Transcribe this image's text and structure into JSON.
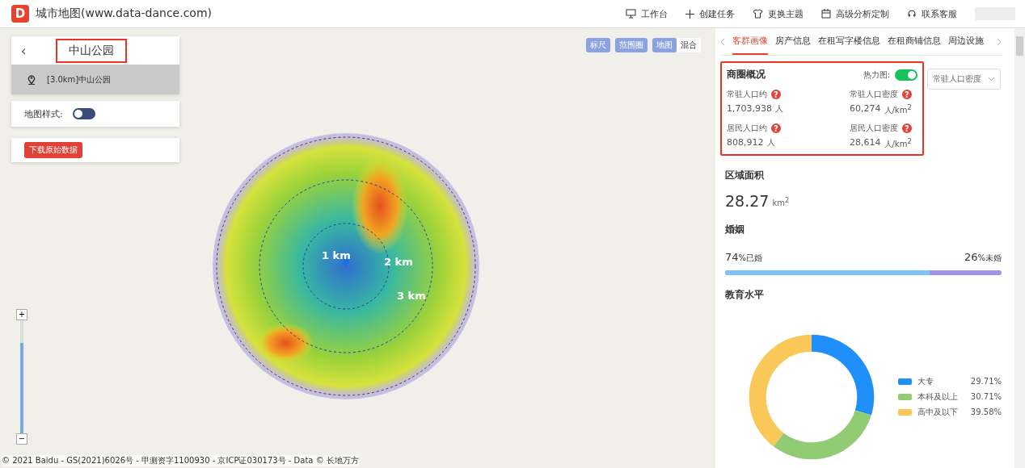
{
  "header": {
    "logo": "D",
    "title": "城市地图(www.data-dance.com)",
    "nav": [
      {
        "label": "工作台",
        "kind": "monitor"
      },
      {
        "label": "创建任务",
        "kind": "plus"
      },
      {
        "label": "更换主题",
        "kind": "shirt"
      },
      {
        "label": "高级分析定制",
        "kind": "calendar"
      },
      {
        "label": "联系客服",
        "kind": "headset"
      }
    ]
  },
  "search_panel": {
    "back": "‹",
    "title": "中山公园",
    "result": "[3.0km]中山公园",
    "map_style": {
      "label": "地图样式:",
      "on": false
    },
    "download_button": "下载原始数据"
  },
  "map": {
    "tools": [
      {
        "label": "标尺",
        "selected": false
      },
      {
        "label": "范围圈",
        "selected": false
      }
    ],
    "layers": [
      {
        "label": "地图",
        "selected": false
      },
      {
        "label": "混合",
        "selected": true
      }
    ],
    "rings": [
      "1 km",
      "2 km",
      "3 km"
    ],
    "zoom": {
      "in": "+",
      "out": "−",
      "level": 0.8
    },
    "attribution": "© 2021 Baidu - GS(2021)6026号 - 甲测资字1100930 - 京ICP证030173号 - Data © 长地万方"
  },
  "details": {
    "tabs": [
      {
        "label": "客群画像",
        "selected": true
      },
      {
        "label": "房产信息",
        "selected": false
      },
      {
        "label": "在租写字楼信息",
        "selected": false
      },
      {
        "label": "在租商铺信息",
        "selected": false
      },
      {
        "label": "周边设施",
        "selected": false
      }
    ],
    "overview": {
      "title": "商圈概况",
      "heatmap": {
        "label": "热力图:",
        "on": true
      },
      "dropdown": "常驻人口密度",
      "stats": [
        {
          "label": "常驻人口约",
          "help": "?",
          "value": "1,703,938",
          "unit": "人"
        },
        {
          "label": "常驻人口密度",
          "help": "?",
          "value": "60,274",
          "unit": "人/km$^{2}$"
        },
        {
          "label": "居民人口约",
          "help": "?",
          "value": "808,912",
          "unit": "人"
        },
        {
          "label": "居民人口密度",
          "help": "?",
          "value": "28,614",
          "unit": "人/km$^{2}$"
        }
      ]
    },
    "area": {
      "title": "区域面积",
      "value": "28.27",
      "unit": "km$^{2}$"
    },
    "marriage": {
      "title": "婚姻",
      "married": {
        "percent": "74",
        "label": "%已婚"
      },
      "unmarried": {
        "percent": "26",
        "label": "%未婚"
      },
      "level": 0.74
    },
    "education": {
      "legend": [
        {
          "value": "29.71%",
          "color": "#1e8ffb"
        },
        {
          "value": "30.71%",
          "color": "#91cb74"
        },
        {
          "value": "39.58%",
          "color": "#fac858"
        }
      ],
      "chart_data": {
        "type": "donut",
        "title": "教育水平",
        "categories": [
          "大专",
          "本科及以上",
          "高中及以下"
        ],
        "series": [
          {
            "values": [
              29.71,
              30.71,
              39.58
            ]
          }
        ]
      }
    }
  }
}
